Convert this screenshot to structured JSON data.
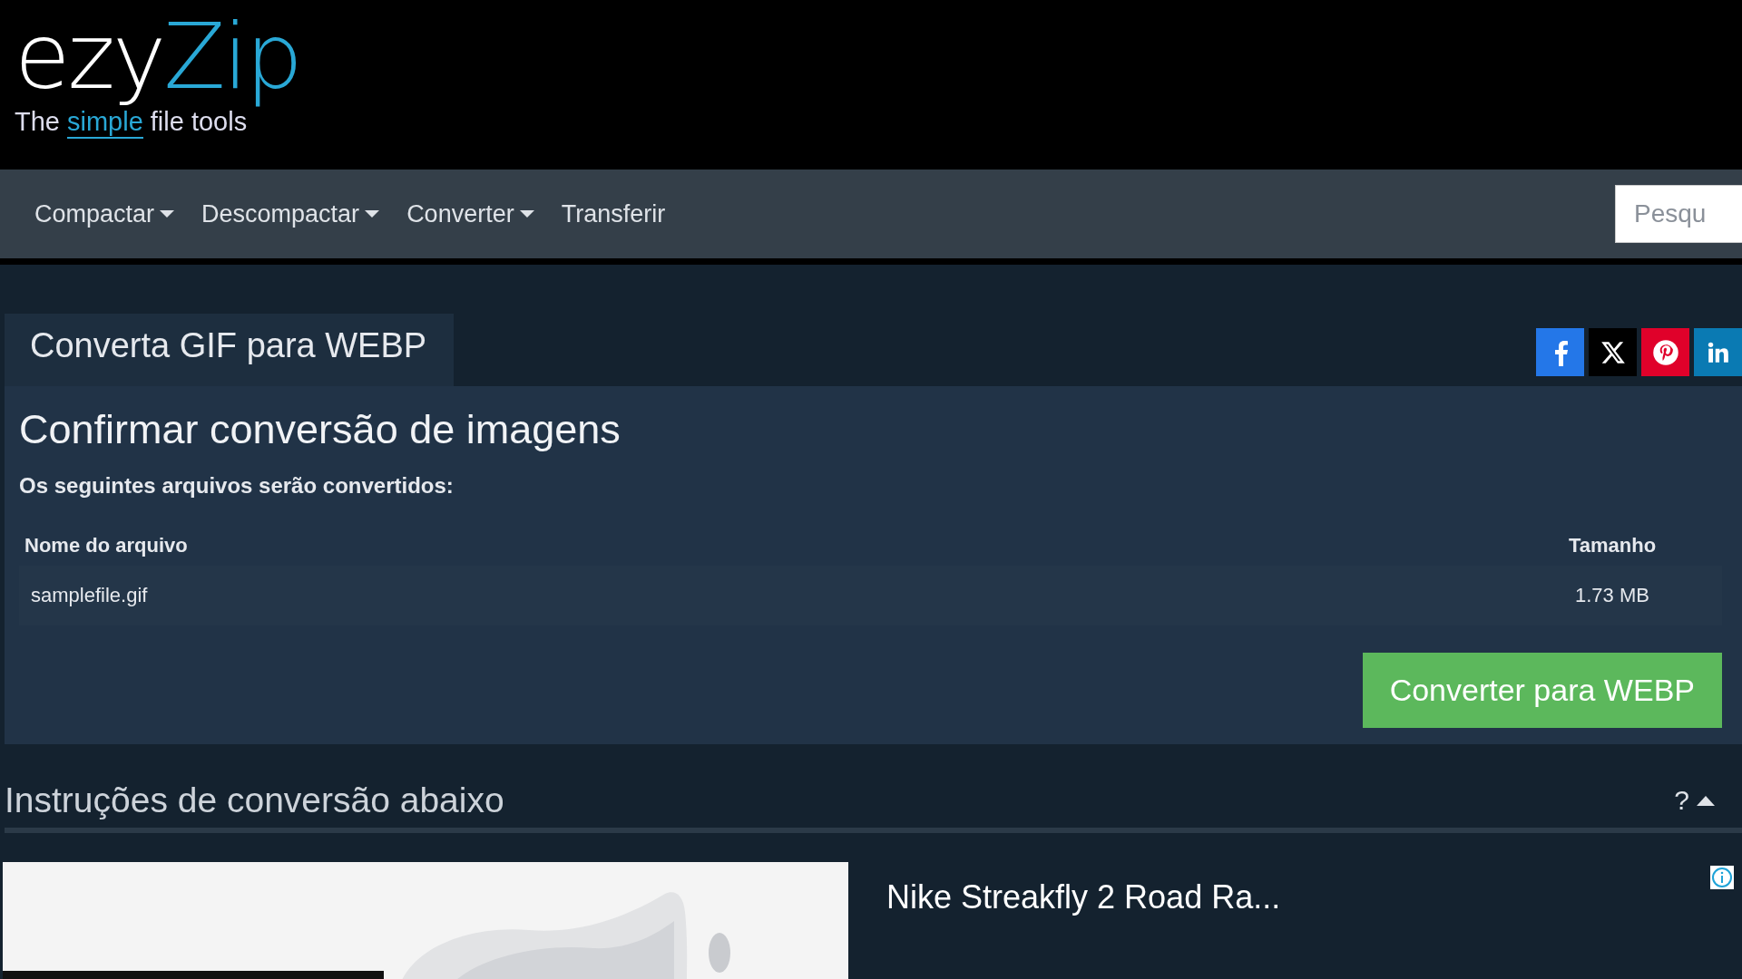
{
  "logo": {
    "word_plain": "ezy",
    "word_accent": "Zip",
    "tagline_start": "The",
    "tagline_accent": "simple",
    "tagline_end": "file tools"
  },
  "nav": {
    "items": [
      {
        "label": "Compactar",
        "dropdown": true
      },
      {
        "label": "Descompactar",
        "dropdown": true
      },
      {
        "label": "Converter",
        "dropdown": true
      },
      {
        "label": "Transferir",
        "dropdown": false
      }
    ],
    "search": {
      "placeholder": "Pesqu"
    }
  },
  "tab": {
    "label": "Converta GIF para WEBP"
  },
  "share": [
    {
      "kind": "facebook",
      "color": "#2477e8"
    },
    {
      "kind": "x",
      "color": "#000000"
    },
    {
      "kind": "pinterest",
      "color": "#e0012a"
    },
    {
      "kind": "linkedin",
      "color": "#0a7ab3"
    }
  ],
  "panel": {
    "title": "Confirmar conversão de imagens",
    "subtitle": "Os seguintes arquivos serão convertidos:",
    "table": {
      "columns": [
        "Nome do arquivo",
        "Tamanho"
      ],
      "rows": [
        [
          "samplefile.gif",
          "1.73 MB"
        ]
      ]
    },
    "button": "Converter para WEBP"
  },
  "instructions": {
    "title": "Instruções de conversão abaixo",
    "help": "?",
    "expanded": true
  },
  "ad": {
    "title": "Nike Streakfly 2 Road Ra..."
  }
}
